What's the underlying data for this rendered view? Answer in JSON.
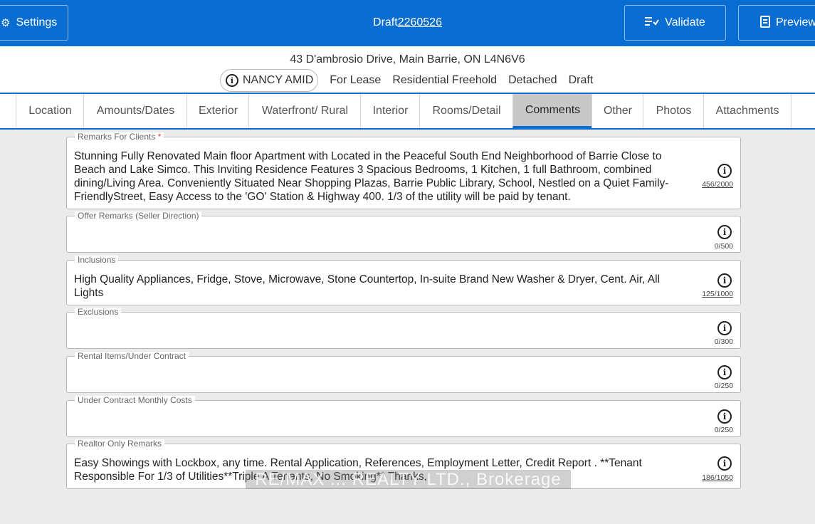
{
  "topbar": {
    "settings_label": "Settings",
    "settings_icon": "gear-icon",
    "draft_prefix": "Draft",
    "draft_number": "2260526",
    "validate_label": "Validate",
    "validate_icon": "validate-list-icon",
    "preview_label": "Preview",
    "preview_icon": "document-icon"
  },
  "listing": {
    "address": "43 D'ambrosio Drive, Main Barrie, ON L4N6V6",
    "agent": "NANCY AMID",
    "type": "For Lease",
    "class": "Residential Freehold",
    "style": "Detached",
    "status": "Draft"
  },
  "tabs": [
    {
      "label": "Location"
    },
    {
      "label": "Amounts/Dates"
    },
    {
      "label": "Exterior"
    },
    {
      "label": "Waterfront/ Rural"
    },
    {
      "label": "Interior"
    },
    {
      "label": "Rooms/Detail"
    },
    {
      "label": "Comments"
    },
    {
      "label": "Other"
    },
    {
      "label": "Photos"
    },
    {
      "label": "Attachments"
    }
  ],
  "active_tab": "Comments",
  "fields": {
    "remarks_clients": {
      "label": "Remarks For Clients",
      "required_mark": "*",
      "value": "Stunning Fully Renovated Main floor Apartment with Located in the Peaceful South End Neighborhood of Barrie Close to Beach and Lake Simco. This Inviting Residence Features 3 Spacious Bedrooms, 1 Kitchen, 1 full Bathroom, combined dining/Living Area. Conveniently Situated Near Shopping Plazas, Barrie Public Library, School, Nestled on a Quiet Family-FriendlyStreet, Easy Access to the 'GO' Station & Highway 400. 1/3 of the utility will be paid by tenant.",
      "count": "456/2000"
    },
    "offer_remarks": {
      "label": "Offer Remarks (Seller Direction)",
      "value": "",
      "count": "0/500"
    },
    "inclusions": {
      "label": "Inclusions",
      "value": "High Quality Appliances, Fridge, Stove, Microwave, Stone Countertop, In-suite Brand New Washer & Dryer, Cent. Air, All Lights",
      "count": "125/1000"
    },
    "exclusions": {
      "label": "Exclusions",
      "value": "",
      "count": "0/300"
    },
    "rental_items": {
      "label": "Rental Items/Under Contract",
      "value": "",
      "count": "0/250"
    },
    "under_contract_costs": {
      "label": "Under Contract Monthly Costs",
      "value": "",
      "count": "0/250"
    },
    "realtor_remarks": {
      "label": "Realtor Only Remarks",
      "value": "Easy Showings with Lockbox, any time. Rental Application, References, Employment Letter, Credit Report . **Tenant Responsible For 1/3 of Utilities**Triple A Tenants, No Smoking** Thanks,",
      "count": "186/1050"
    }
  },
  "watermark": "RE/MAX ... REALTY LTD., Brokerage",
  "colors": {
    "primary": "#0a6dd1",
    "active_tab_bg": "#c8c8c8",
    "background": "#ebebeb",
    "required": "#e53935"
  }
}
